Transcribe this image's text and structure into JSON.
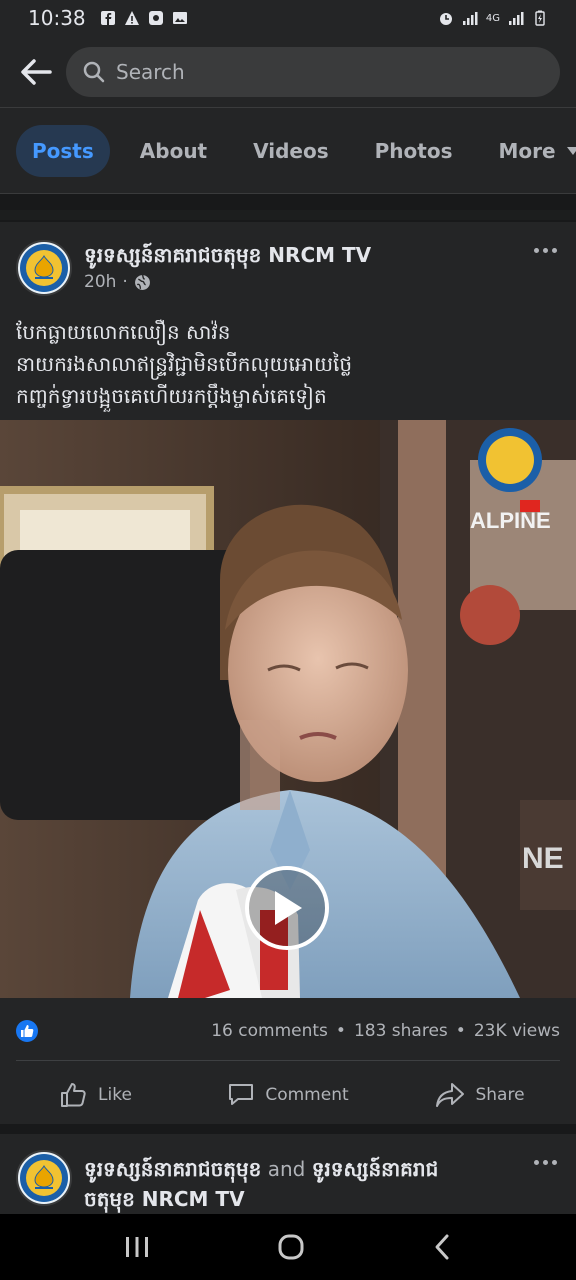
{
  "status_bar": {
    "time": "10:38",
    "network_label": "4G"
  },
  "search": {
    "placeholder": "Search"
  },
  "tabs": [
    {
      "label": "Posts",
      "active": true
    },
    {
      "label": "About",
      "active": false
    },
    {
      "label": "Videos",
      "active": false
    },
    {
      "label": "Photos",
      "active": false
    },
    {
      "label": "More",
      "active": false
    }
  ],
  "post": {
    "page_name": "ទូរទស្សន៍នាគរាជចតុមុខ NRCM TV",
    "time": "20h",
    "text": "បែកធ្លាយលោកឈឿន សាវ៉ន\nនាយករងសាលាឥន្ទ្រវិជ្ជាមិនបើកលុយអោយថ្លៃ\nកញ្ចក់ទ្វារបង្អួចគេហើយរកប្តឹងម្ចាស់គេទៀត",
    "video": {
      "brand_text": "ALPINE"
    },
    "stats": {
      "comments": "16 comments",
      "shares": "183 shares",
      "views": "23K views"
    },
    "actions": {
      "like": "Like",
      "comment": "Comment",
      "share": "Share"
    }
  },
  "post2": {
    "name_a": "ទូរទស្សន៍នាគរាជចតុមុខ",
    "conjunction": "and",
    "name_b": "ទូរទស្សន៍នាគរាជ",
    "name_b_cont": "ចតុមុខ NRCM TV"
  },
  "colors": {
    "background": "#18191a",
    "card": "#242526",
    "accent": "#4599ff",
    "active_tab_bg": "#263951",
    "like_blue": "#1877f2"
  }
}
